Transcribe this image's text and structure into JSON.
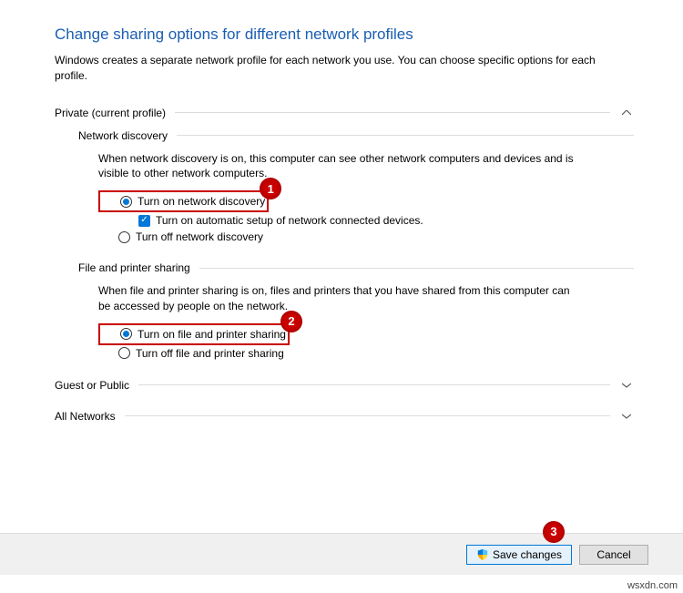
{
  "title": "Change sharing options for different network profiles",
  "description": "Windows creates a separate network profile for each network you use. You can choose specific options for each profile.",
  "sections": {
    "private": {
      "label": "Private (current profile)",
      "expanded": true,
      "groups": {
        "networkDiscovery": {
          "title": "Network discovery",
          "description": "When network discovery is on, this computer can see other network computers and devices and is visible to other network computers.",
          "optOn": "Turn on network discovery",
          "optAuto": "Turn on automatic setup of network connected devices.",
          "optOff": "Turn off network discovery"
        },
        "filePrinter": {
          "title": "File and printer sharing",
          "description": "When file and printer sharing is on, files and printers that you have shared from this computer can be accessed by people on the network.",
          "optOn": "Turn on file and printer sharing",
          "optOff": "Turn off file and printer sharing"
        }
      }
    },
    "guest": {
      "label": "Guest or Public"
    },
    "all": {
      "label": "All Networks"
    }
  },
  "buttons": {
    "save": "Save changes",
    "cancel": "Cancel"
  },
  "callouts": {
    "c1": "1",
    "c2": "2",
    "c3": "3"
  },
  "watermark": "wsxdn.com"
}
